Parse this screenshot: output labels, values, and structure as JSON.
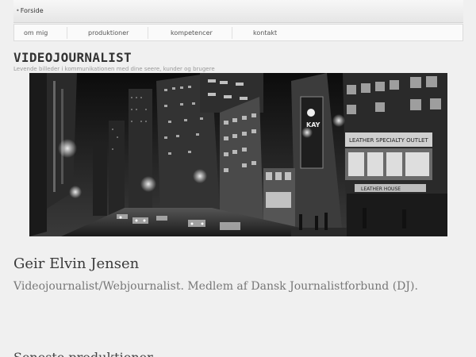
{
  "topbar": {
    "home_label": "Forside",
    "bullet": "•"
  },
  "nav": {
    "items": [
      "om mig",
      "produktioner",
      "kompetencer",
      "kontakt"
    ]
  },
  "header": {
    "title": "VIDEOJOURNALIST",
    "tagline": "Levende billeder i kommunikationen med dine seere, kunder og brugere"
  },
  "hero": {
    "signs": {
      "kay": "KAY",
      "outlet": "LEATHER SPECIALTY OUTLET",
      "house": "LEATHER HOUSE"
    }
  },
  "profile": {
    "name": "Geir Elvin Jensen",
    "description": "Videojournalist/Webjournalist. Medlem af Dansk Journalistforbund (DJ)."
  },
  "section": {
    "next_heading": "Seneste produktioner"
  }
}
